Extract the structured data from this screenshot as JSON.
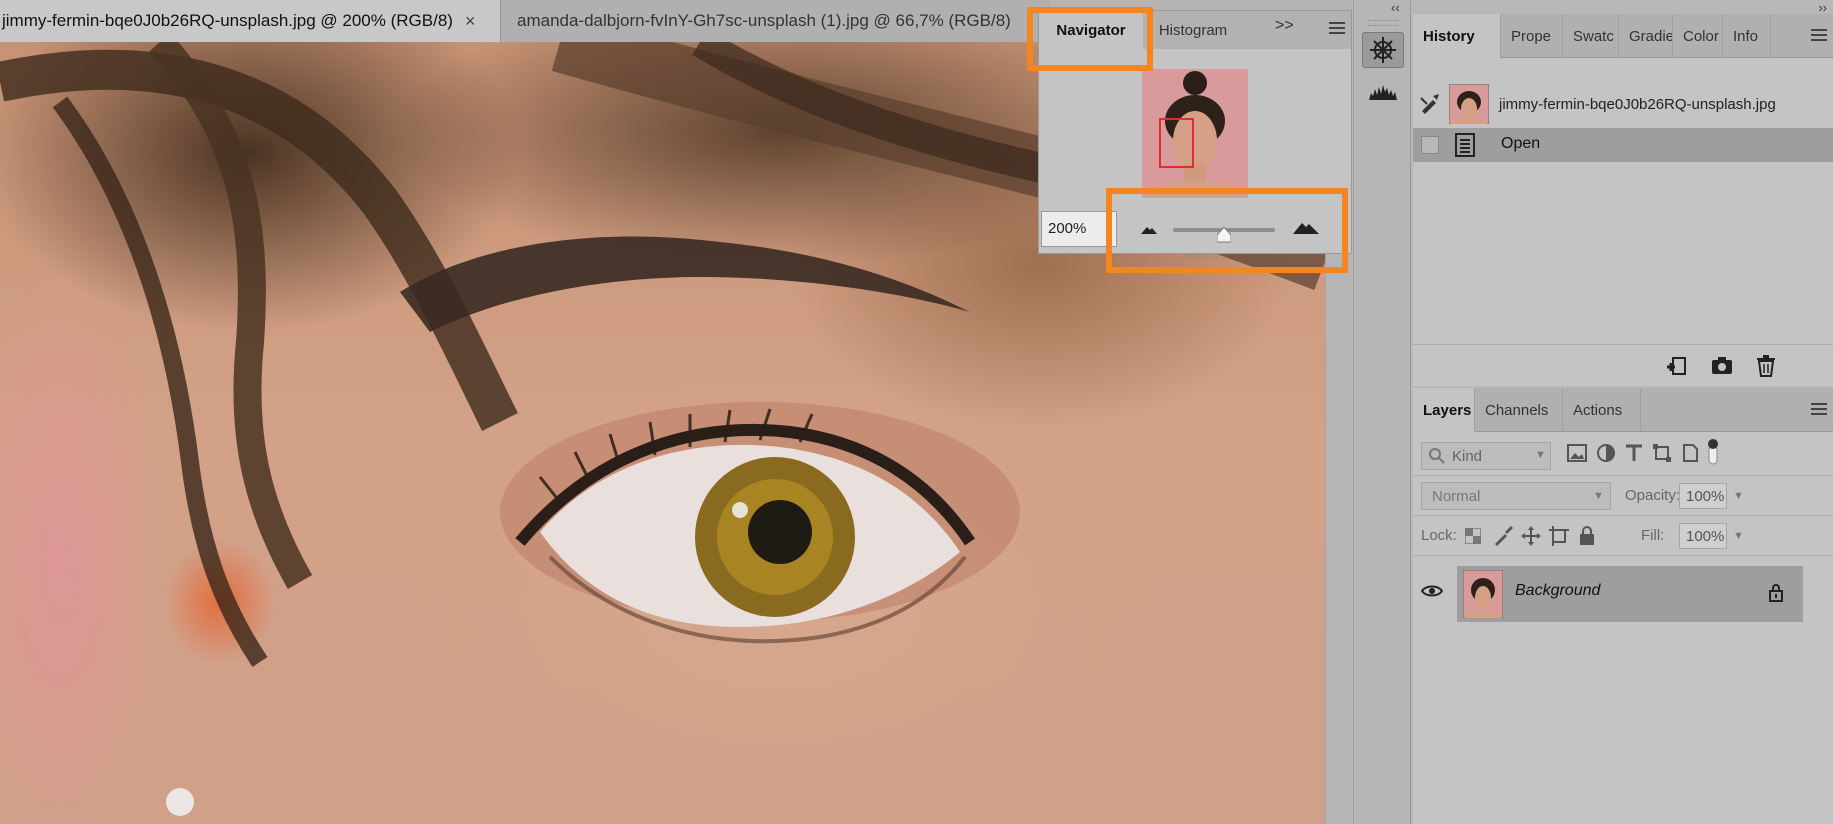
{
  "document_tabs": [
    {
      "label": "jimmy-fermin-bqe0J0b26RQ-unsplash.jpg @ 200% (RGB/8)",
      "close": "×"
    },
    {
      "label": "amanda-dalbjorn-fvInY-Gh7sc-unsplash (1).jpg @ 66,7% (RGB/8)"
    }
  ],
  "navigator": {
    "tabs": [
      "Navigator",
      "Histogram"
    ],
    "more": ">>",
    "zoom_value": "200%",
    "zoom_slider_fraction": 0.5
  },
  "collapse_arrows": "‹‹",
  "right_collapse_arrows": "››",
  "history_panel": {
    "tabs": [
      "History",
      "Prope",
      "Swatc",
      "Gradie",
      "Color",
      "Info"
    ],
    "snapshot_name": "jimmy-fermin-bqe0J0b26RQ-unsplash.jpg",
    "steps": [
      "Open"
    ]
  },
  "layers_panel": {
    "tabs": [
      "Layers",
      "Channels",
      "Actions"
    ],
    "kind_placeholder": "Kind",
    "blend_mode": "Normal",
    "opacity_label": "Opacity:",
    "opacity_value": "100%",
    "lock_label": "Lock:",
    "fill_label": "Fill:",
    "fill_value": "100%",
    "layers": [
      {
        "name": "Background",
        "locked": true,
        "visible": true
      }
    ]
  },
  "colors": {
    "highlight": "#f5861f",
    "panel_bg": "#c4c4c4",
    "selected_row": "#9e9e9e"
  }
}
